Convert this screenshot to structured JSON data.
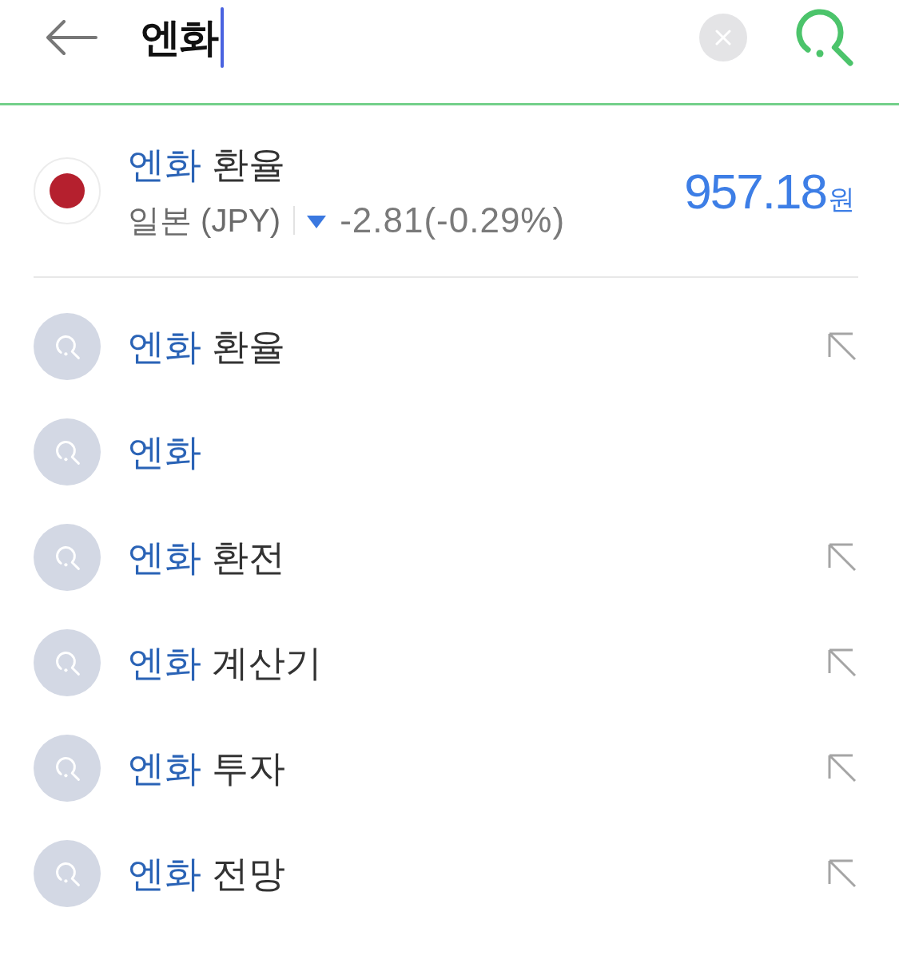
{
  "search_bar": {
    "value": "엔화"
  },
  "currency_card": {
    "title_match": "엔화",
    "title_rest": "환율",
    "country": "일본 (JPY)",
    "falling": true,
    "change": "-2.81(-0.29%)",
    "price": "957.18",
    "unit": "원"
  },
  "suggestions": [
    {
      "match": "엔화",
      "rest": "환율",
      "fill_arrow": true
    },
    {
      "match": "엔화",
      "fill_arrow": false
    },
    {
      "match": "엔화",
      "rest": "환전",
      "fill_arrow": true
    },
    {
      "match": "엔화",
      "rest": "계산기",
      "fill_arrow": true
    },
    {
      "match": "엔화",
      "rest": "투자",
      "fill_arrow": true
    },
    {
      "match": "엔화",
      "rest": "전망",
      "fill_arrow": true
    }
  ]
}
